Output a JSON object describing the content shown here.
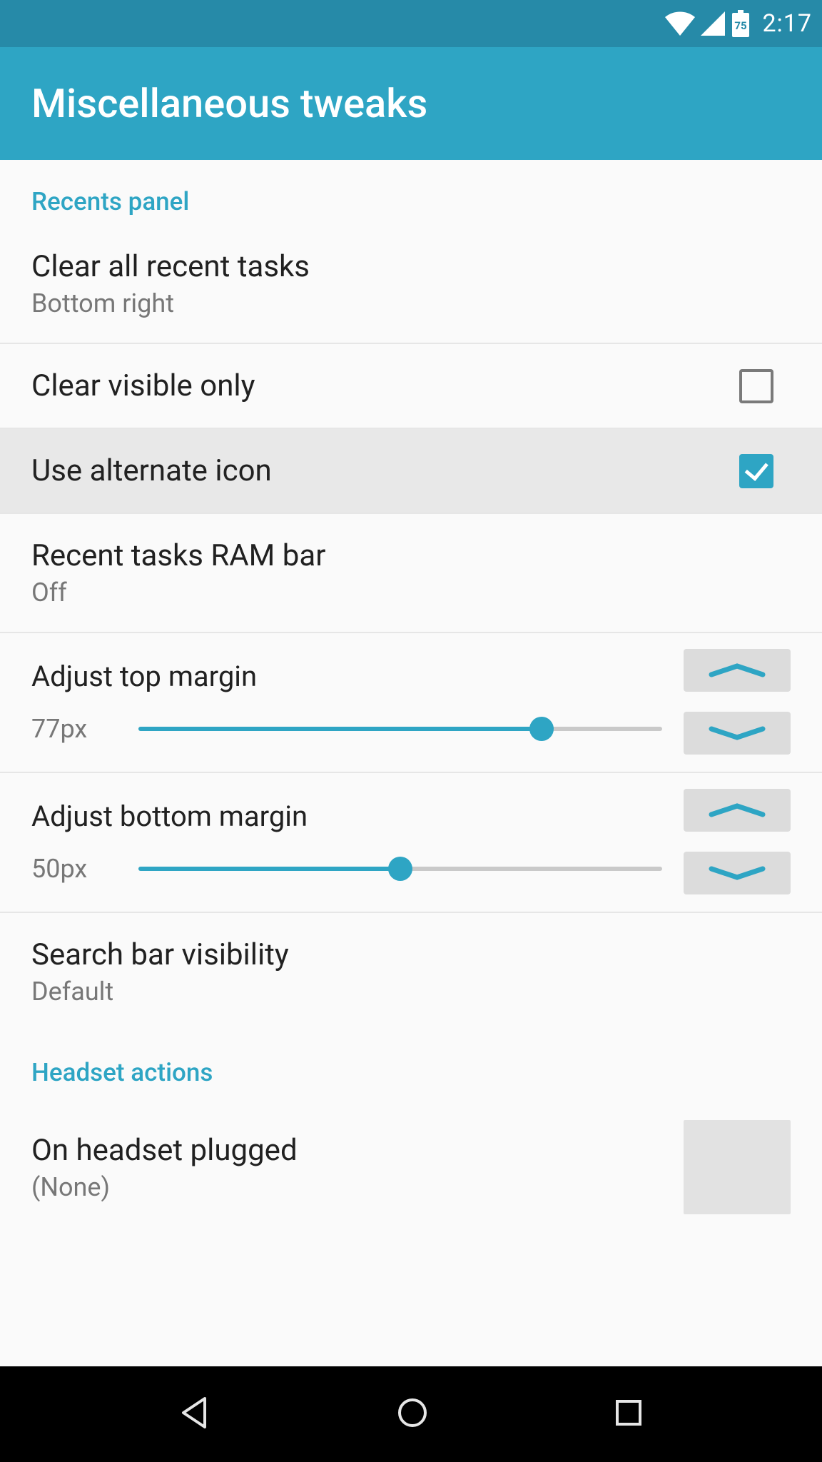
{
  "status_bar": {
    "battery_text": "75",
    "time": "2:17"
  },
  "app_bar": {
    "title": "Miscellaneous tweaks"
  },
  "sections": {
    "recents_panel": {
      "header": "Recents panel",
      "clear_all": {
        "title": "Clear all recent tasks",
        "subtitle": "Bottom right"
      },
      "clear_visible_only": {
        "title": "Clear visible only",
        "checked": false
      },
      "use_alternate_icon": {
        "title": "Use alternate icon",
        "checked": true
      },
      "ram_bar": {
        "title": "Recent tasks RAM bar",
        "subtitle": "Off"
      },
      "adjust_top_margin": {
        "title": "Adjust top margin",
        "value": "77px",
        "percent": 77
      },
      "adjust_bottom_margin": {
        "title": "Adjust bottom margin",
        "value": "50px",
        "percent": 50
      },
      "search_bar_visibility": {
        "title": "Search bar visibility",
        "subtitle": "Default"
      }
    },
    "headset_actions": {
      "header": "Headset actions",
      "on_plugged": {
        "title": "On headset plugged",
        "subtitle": "(None)"
      }
    }
  }
}
